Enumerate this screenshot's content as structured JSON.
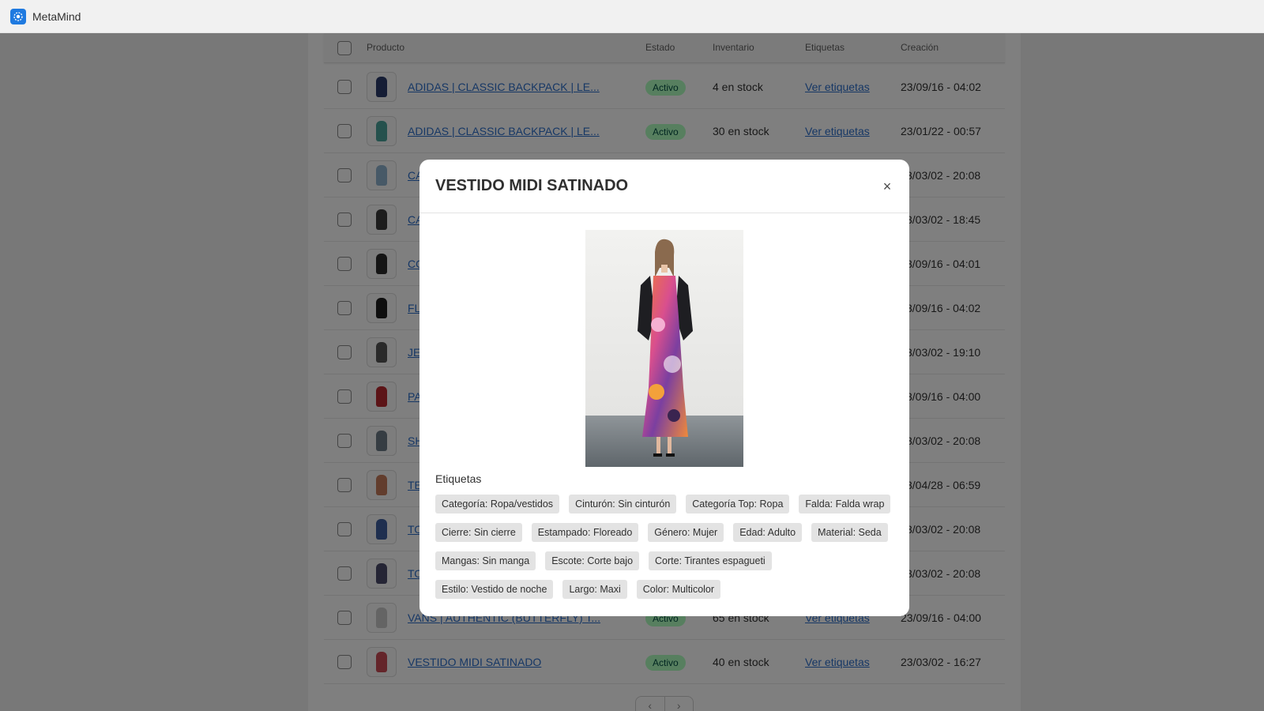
{
  "app": {
    "title": "MetaMind"
  },
  "table": {
    "headers": {
      "product": "Producto",
      "status": "Estado",
      "inventory": "Inventario",
      "tags": "Etiquetas",
      "created": "Creación"
    },
    "rows": [
      {
        "name": "ADIDAS | CLASSIC BACKPACK | LE...",
        "status": "Activo",
        "stock": "4 en stock",
        "tags_link": "Ver etiquetas",
        "date": "23/09/16 - 04:02"
      },
      {
        "name": "ADIDAS | CLASSIC BACKPACK | LE...",
        "status": "Activo",
        "stock": "30 en stock",
        "tags_link": "Ver etiquetas",
        "date": "23/01/22 - 00:57"
      },
      {
        "name": "CA",
        "date": "3/03/02 - 20:08"
      },
      {
        "name": "CA",
        "date": "3/03/02 - 18:45"
      },
      {
        "name": "CO",
        "date": "3/09/16 - 04:01"
      },
      {
        "name": "FL",
        "date": "3/09/16 - 04:02"
      },
      {
        "name": "JE",
        "date": "3/03/02 - 19:10"
      },
      {
        "name": "PA",
        "date": "3/09/16 - 04:00"
      },
      {
        "name": "SH",
        "date": "3/03/02 - 20:08"
      },
      {
        "name": "TE",
        "date": "3/04/28 - 06:59"
      },
      {
        "name": "TO",
        "date": "3/03/02 - 20:08"
      },
      {
        "name": "TO",
        "date": "3/03/02 - 20:08"
      },
      {
        "name": "VANS | AUTHENTIC (BUTTERFLY) T...",
        "status": "Activo",
        "stock": "65 en stock",
        "tags_link": "Ver etiquetas",
        "date": "23/09/16 - 04:00"
      },
      {
        "name": "VESTIDO MIDI SATINADO",
        "status": "Activo",
        "stock": "40 en stock",
        "tags_link": "Ver etiquetas",
        "date": "23/03/02 - 16:27"
      }
    ]
  },
  "pagination": {
    "prev": "‹",
    "next": "›"
  },
  "modal": {
    "title": "VESTIDO MIDI SATINADO",
    "close": "×",
    "tags_heading": "Etiquetas",
    "tags": [
      "Categoría: Ropa/vestidos",
      "Cinturón: Sin cinturón",
      "Categoría Top: Ropa",
      "Falda: Falda wrap",
      "Cierre: Sin cierre",
      "Estampado: Floreado",
      "Género: Mujer",
      "Edad: Adulto",
      "Material: Seda",
      "Mangas: Sin manga",
      "Escote: Corte bajo",
      "Corte: Tirantes espagueti",
      "Estilo: Vestido de noche",
      "Largo: Maxi",
      "Color: Multicolor"
    ]
  },
  "colors": {
    "link": "#2c6ecb",
    "badge_bg": "#affebf",
    "badge_text": "#014b40",
    "accent": "#1f7ae0"
  }
}
